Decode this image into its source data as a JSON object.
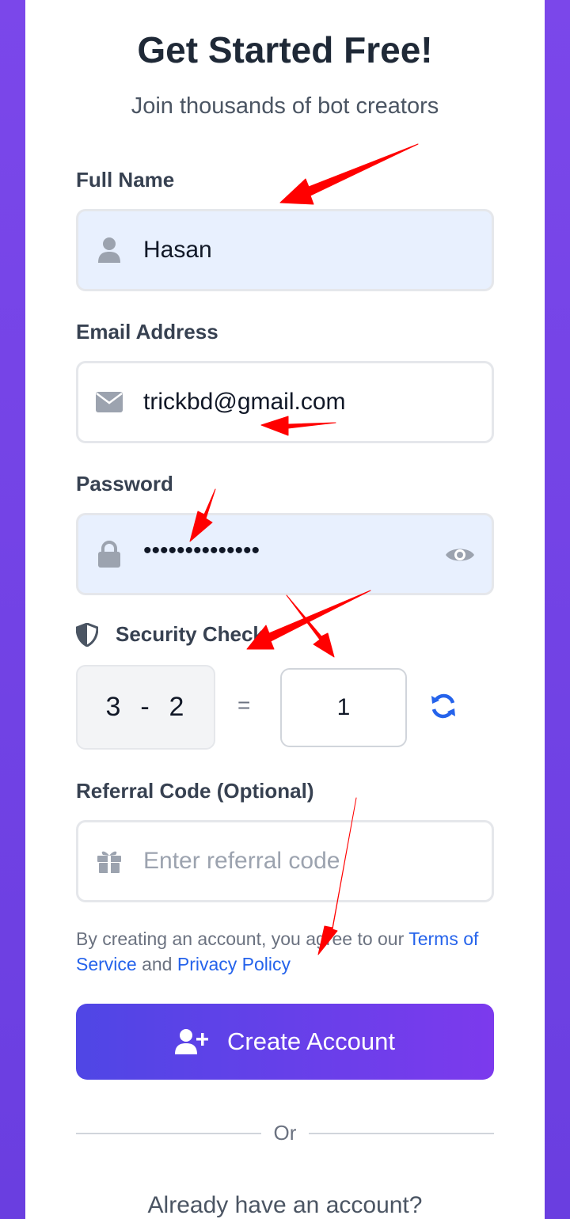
{
  "header": {
    "title": "Get Started Free!",
    "subtitle": "Join thousands of bot creators"
  },
  "form": {
    "full_name": {
      "label": "Full Name",
      "value": "Hasan",
      "icon": "user-icon"
    },
    "email": {
      "label": "Email Address",
      "value": "trickbd@gmail.com",
      "icon": "envelope-icon"
    },
    "password": {
      "label": "Password",
      "value": "••••••••••••••",
      "icon": "lock-icon",
      "toggle_icon": "eye-icon"
    },
    "security": {
      "label": "Security Check",
      "icon": "shield-icon",
      "question": "3  -  2",
      "equals": "=",
      "answer": "1",
      "refresh_icon": "refresh-icon"
    },
    "referral": {
      "label": "Referral Code (Optional)",
      "placeholder": "Enter referral code",
      "icon": "gift-icon"
    }
  },
  "terms": {
    "prefix": "By creating an account, you agree to our ",
    "terms_link": "Terms of Service",
    "middle": " and ",
    "privacy_link": "Privacy Policy"
  },
  "create_button": {
    "label": "Create Account",
    "icon": "user-plus-icon"
  },
  "divider": {
    "label": "Or"
  },
  "footer": {
    "already": "Already have an account?"
  },
  "colors": {
    "background": "#7b47ea",
    "button_start": "#4f46e5",
    "button_end": "#7c3aed",
    "link": "#2563eb",
    "annotation_arrow": "#ff0000"
  }
}
